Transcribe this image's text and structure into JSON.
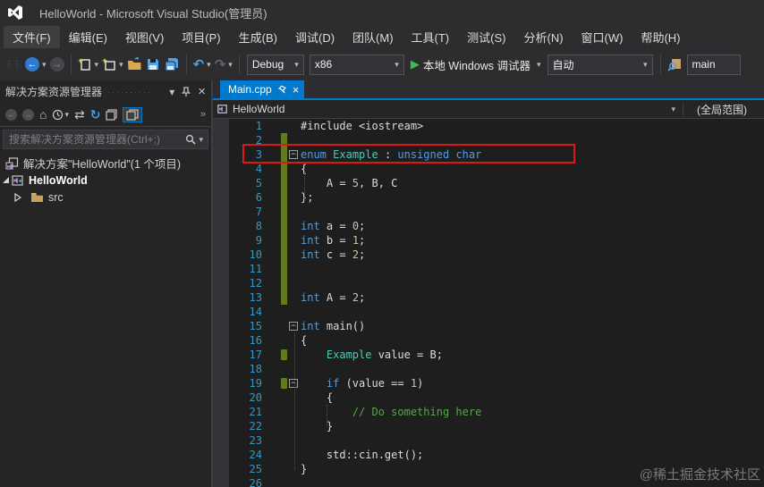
{
  "window": {
    "title": "HelloWorld - Microsoft Visual Studio(管理员)"
  },
  "menu": {
    "items": [
      {
        "id": "file",
        "label": "文件(F)"
      },
      {
        "id": "edit",
        "label": "编辑(E)"
      },
      {
        "id": "view",
        "label": "视图(V)"
      },
      {
        "id": "project",
        "label": "项目(P)"
      },
      {
        "id": "build",
        "label": "生成(B)"
      },
      {
        "id": "debug",
        "label": "调试(D)"
      },
      {
        "id": "team",
        "label": "团队(M)"
      },
      {
        "id": "tools",
        "label": "工具(T)"
      },
      {
        "id": "test",
        "label": "测试(S)"
      },
      {
        "id": "analyze",
        "label": "分析(N)"
      },
      {
        "id": "window",
        "label": "窗口(W)"
      },
      {
        "id": "help",
        "label": "帮助(H)"
      }
    ]
  },
  "toolbar": {
    "configuration": "Debug",
    "platform": "x86",
    "start_label": "本地 Windows 调试器",
    "auto_label": "自动",
    "search_value": "main"
  },
  "solution_explorer": {
    "title": "解决方案资源管理器",
    "search_placeholder": "搜索解决方案资源管理器(Ctrl+;)",
    "solution_label": "解决方案\"HelloWorld\"(1 个项目)",
    "project_label": "HelloWorld",
    "folder_label": "src"
  },
  "editor": {
    "tab_label": "Main.cpp",
    "breadcrumb_project": "HelloWorld",
    "scope_label": "(全局范围)",
    "fold_glyph": "−",
    "colors": {
      "keyword": "#569CD6",
      "type": "#4EC9B0",
      "comment": "#57A64A",
      "number": "#B5CEA8",
      "plain": "#DCDCDC",
      "line_number": "#3399C2",
      "changed_bar": "#617B1F",
      "annotation": "#DD1616",
      "tab_active": "#007ACC",
      "background": "#1E1E1E"
    },
    "lines": [
      {
        "n": 1,
        "fold": false,
        "chg": "",
        "tok": [
          [
            "p",
            "#include <iostream>"
          ]
        ]
      },
      {
        "n": 2,
        "fold": false,
        "chg": "full",
        "tok": []
      },
      {
        "n": 3,
        "fold": true,
        "chg": "full",
        "tok": [
          [
            "k",
            "enum"
          ],
          [
            "p",
            " "
          ],
          [
            "t",
            "Example"
          ],
          [
            "p",
            " : "
          ],
          [
            "k",
            "unsigned"
          ],
          [
            "p",
            " "
          ],
          [
            "k",
            "char"
          ]
        ]
      },
      {
        "n": 4,
        "fold": false,
        "chg": "full",
        "tok": [
          [
            "p",
            "{"
          ]
        ]
      },
      {
        "n": 5,
        "fold": false,
        "chg": "full",
        "tok": [
          [
            "p",
            "    A = "
          ],
          [
            "n2",
            "5"
          ],
          [
            "p",
            ", B, C"
          ]
        ]
      },
      {
        "n": 6,
        "fold": false,
        "chg": "full",
        "tok": [
          [
            "p",
            "};"
          ]
        ]
      },
      {
        "n": 7,
        "fold": false,
        "chg": "full",
        "tok": []
      },
      {
        "n": 8,
        "fold": false,
        "chg": "full",
        "tok": [
          [
            "k",
            "int"
          ],
          [
            "p",
            " a = "
          ],
          [
            "n2",
            "0"
          ],
          [
            "p",
            ";"
          ]
        ]
      },
      {
        "n": 9,
        "fold": false,
        "chg": "full",
        "tok": [
          [
            "k",
            "int"
          ],
          [
            "p",
            " b = "
          ],
          [
            "n2",
            "1"
          ],
          [
            "p",
            ";"
          ]
        ]
      },
      {
        "n": 10,
        "fold": false,
        "chg": "full",
        "tok": [
          [
            "k",
            "int"
          ],
          [
            "p",
            " c = "
          ],
          [
            "n2",
            "2"
          ],
          [
            "p",
            ";"
          ]
        ]
      },
      {
        "n": 11,
        "fold": false,
        "chg": "full",
        "tok": []
      },
      {
        "n": 12,
        "fold": false,
        "chg": "full",
        "tok": []
      },
      {
        "n": 13,
        "fold": false,
        "chg": "full",
        "tok": [
          [
            "k",
            "int"
          ],
          [
            "p",
            " A = "
          ],
          [
            "n2",
            "2"
          ],
          [
            "p",
            ";"
          ]
        ]
      },
      {
        "n": 14,
        "fold": false,
        "chg": "",
        "tok": []
      },
      {
        "n": 15,
        "fold": true,
        "chg": "",
        "tok": [
          [
            "k",
            "int"
          ],
          [
            "p",
            " main()"
          ]
        ]
      },
      {
        "n": 16,
        "fold": false,
        "chg": "",
        "tok": [
          [
            "p",
            "{"
          ]
        ]
      },
      {
        "n": 17,
        "fold": false,
        "chg": "short",
        "tok": [
          [
            "p",
            "    "
          ],
          [
            "t",
            "Example"
          ],
          [
            "p",
            " value = B;"
          ]
        ]
      },
      {
        "n": 18,
        "fold": false,
        "chg": "",
        "tok": []
      },
      {
        "n": 19,
        "fold": true,
        "chg": "short",
        "tok": [
          [
            "p",
            "    "
          ],
          [
            "k",
            "if"
          ],
          [
            "p",
            " (value == "
          ],
          [
            "n2",
            "1"
          ],
          [
            "p",
            ")"
          ]
        ]
      },
      {
        "n": 20,
        "fold": false,
        "chg": "",
        "tok": [
          [
            "p",
            "    {"
          ]
        ]
      },
      {
        "n": 21,
        "fold": false,
        "chg": "",
        "tok": [
          [
            "c",
            "        // Do something here"
          ]
        ]
      },
      {
        "n": 22,
        "fold": false,
        "chg": "",
        "tok": [
          [
            "p",
            "    }"
          ]
        ]
      },
      {
        "n": 23,
        "fold": false,
        "chg": "",
        "tok": []
      },
      {
        "n": 24,
        "fold": false,
        "chg": "",
        "tok": [
          [
            "p",
            "    std::cin.get();"
          ]
        ]
      },
      {
        "n": 25,
        "fold": false,
        "chg": "",
        "tok": [
          [
            "p",
            "}"
          ]
        ]
      },
      {
        "n": 26,
        "fold": false,
        "chg": "",
        "tok": []
      }
    ]
  },
  "icons": {
    "caret_down": "▾",
    "close": "×",
    "home": "⌂",
    "refresh": "↻",
    "sync": "⇄",
    "undo": "↶",
    "redo": "↷",
    "play": "▶",
    "back_arrow": "←",
    "forward_arrow": "→",
    "overflow": "»",
    "grip": "⋮⋮",
    "se_grip_dots": "··········"
  },
  "watermark": "@稀土掘金技术社区"
}
